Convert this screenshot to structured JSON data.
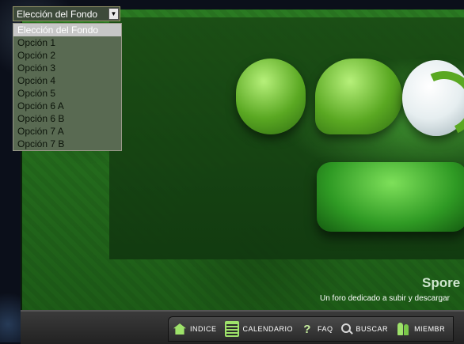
{
  "selector": {
    "current": "Elección del Fondo",
    "options": [
      "Elección del Fondo",
      "Opción 1",
      "Opción 2",
      "Opción 3",
      "Opción 4",
      "Opción 5",
      "Opción 6 A",
      "Opción 6 B",
      "Opción 7 A",
      "Opción 7 B"
    ],
    "highlighted_index": 0
  },
  "banner": {
    "title": "Spore",
    "subtitle": "Un foro dedicado a subir y descargar"
  },
  "nav": {
    "items": [
      {
        "label": "INDICE",
        "icon": "home-icon"
      },
      {
        "label": "CALENDARIO",
        "icon": "calendar-icon"
      },
      {
        "label": "FAQ",
        "icon": "question-icon"
      },
      {
        "label": "BUSCAR",
        "icon": "search-icon"
      },
      {
        "label": "MIEMBR",
        "icon": "members-icon"
      }
    ]
  },
  "colors": {
    "accent": "#9ee26a",
    "banner_green": "#1f5f1a",
    "dropdown_bg": "#596a52",
    "highlight": "#c7c7c7"
  }
}
